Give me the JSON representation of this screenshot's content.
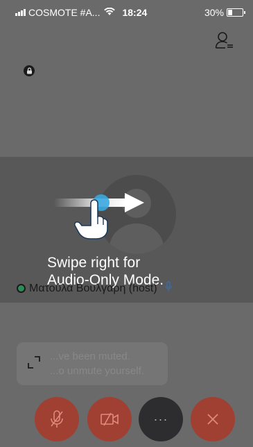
{
  "status_bar": {
    "carrier": "COSMOTE #A...",
    "time": "18:24",
    "battery": "30%",
    "battery_level": 0.3
  },
  "header": {
    "participants_icon": "participants-list-icon",
    "lock_icon": "lock-icon"
  },
  "swipe_hint": {
    "text_line1": "Swipe right for",
    "text_line2": "Audio-Only Mode.",
    "arrow_icon": "swipe-arrow-icon",
    "hand_icon": "pointing-hand-icon"
  },
  "participant": {
    "name": "Ματούλα Βουλγαρη (host)",
    "status_color": "#2e8b57"
  },
  "toast": {
    "line1": "...ve been muted.",
    "line2": "...o unmute yourself."
  },
  "controls": {
    "mute_icon": "microphone-muted-icon",
    "video_icon": "video-off-icon",
    "more_label": "···",
    "end_icon": "close-icon",
    "accent_color": "#a04033"
  }
}
